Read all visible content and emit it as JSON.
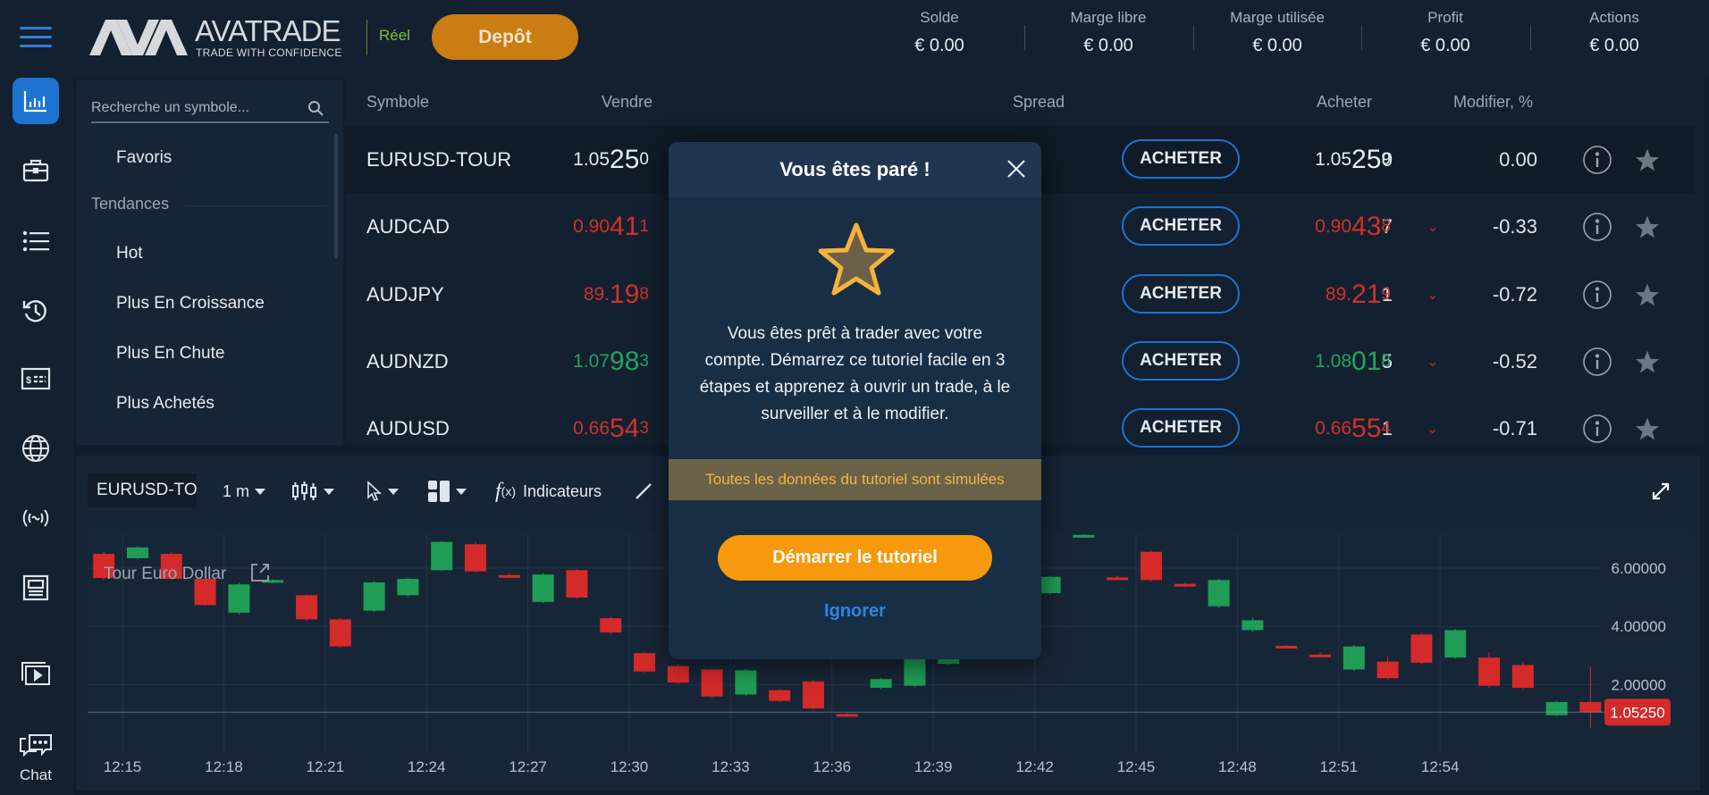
{
  "header": {
    "logo_text": "AVATRADE",
    "logo_tagline": "TRADE WITH CONFIDENCE",
    "account_type": "Réel",
    "deposit_label": "Depôt",
    "stats": [
      {
        "label": "Solde",
        "value": "€ 0.00"
      },
      {
        "label": "Marge libre",
        "value": "€ 0.00"
      },
      {
        "label": "Marge utilisée",
        "value": "€ 0.00"
      },
      {
        "label": "Profit",
        "value": "€ 0.00"
      },
      {
        "label": "Actions",
        "value": "€ 0.00"
      }
    ]
  },
  "rail": {
    "icons": [
      "chart-bars-icon",
      "briefcase-icon",
      "list-icon",
      "history-icon",
      "dollar-card-icon",
      "globe-icon",
      "signal-icon",
      "news-icon",
      "video-icon",
      "chat-icon"
    ],
    "chat_label": "Chat"
  },
  "symbols_panel": {
    "search_placeholder": "Recherche un symbole...",
    "favorites": "Favoris",
    "trends_heading": "Tendances",
    "trends": [
      "Hot",
      "Plus En Croissance",
      "Plus En Chute",
      "Plus Achetés"
    ]
  },
  "table": {
    "headers": {
      "symbol": "Symbole",
      "sell": "Vendre",
      "spread": "Spread",
      "buy": "Acheter",
      "change": "Modifier, %"
    },
    "buy_label": "ACHETER",
    "rows": [
      {
        "symbol": "EURUSD-TOUR",
        "sell": {
          "pre": "1.05",
          "big": "25",
          "post": "0"
        },
        "spread": "0",
        "buy": {
          "pre": "1.05",
          "big": "25",
          "post": "9"
        },
        "change": "0.00",
        "direction": "flat",
        "color": "#e6ebf0"
      },
      {
        "symbol": "AUDCAD",
        "sell": {
          "pre": "0.90",
          "big": "41",
          "post": "1"
        },
        "spread": "7",
        "buy": {
          "pre": "0.90",
          "big": "43",
          "post": "8"
        },
        "change": "-0.33",
        "direction": "down",
        "color": "#d0312d"
      },
      {
        "symbol": "AUDJPY",
        "sell": {
          "pre": "89.",
          "big": "19",
          "post": "8"
        },
        "spread": "1",
        "buy": {
          "pre": "89.",
          "big": "21",
          "post": "9"
        },
        "change": "-0.72",
        "direction": "down",
        "color": "#d0312d"
      },
      {
        "symbol": "AUDNZD",
        "sell": {
          "pre": "1.07",
          "big": "98",
          "post": "3"
        },
        "spread": "5",
        "buy": {
          "pre": "1.08",
          "big": "01",
          "post": "8"
        },
        "change": "-0.52",
        "direction": "down",
        "color": "#22a45d"
      },
      {
        "symbol": "AUDUSD",
        "sell": {
          "pre": "0.66",
          "big": "54",
          "post": "3"
        },
        "spread": "1",
        "buy": {
          "pre": "0.66",
          "big": "55",
          "post": "4"
        },
        "change": "-0.71",
        "direction": "down",
        "color": "#d0312d"
      }
    ]
  },
  "chart_toolbar": {
    "symbol": "EURUSD-TOUR",
    "interval": "1 m",
    "indicators_label": "Indicateurs"
  },
  "chart_data": {
    "type": "candlestick",
    "title": "Tour Euro Dollar",
    "ylim": [
      0,
      7.5
    ],
    "y_ticks": [
      "6.00000",
      "4.00000",
      "2.00000"
    ],
    "x_ticks": [
      "12:15",
      "12:18",
      "12:21",
      "12:24",
      "12:27",
      "12:30",
      "12:33",
      "12:36",
      "12:39",
      "12:42",
      "12:45",
      "12:48",
      "12:51",
      "12:54"
    ],
    "last_price": "1.05250",
    "up_color": "#1f9d55",
    "down_color": "#d42a2a",
    "grid": true,
    "candles": [
      [
        "12:14",
        6.49,
        6.55,
        5.6,
        5.66
      ],
      [
        "12:15",
        6.34,
        6.75,
        6.3,
        6.71
      ],
      [
        "12:16",
        6.49,
        6.55,
        5.6,
        5.63
      ],
      [
        "12:17",
        5.63,
        5.7,
        4.7,
        4.73
      ],
      [
        "12:18",
        4.47,
        5.5,
        4.4,
        5.44
      ],
      [
        "12:19",
        5.51,
        5.62,
        5.48,
        5.59
      ],
      [
        "12:20",
        5.07,
        5.1,
        4.2,
        4.24
      ],
      [
        "12:21",
        4.24,
        4.28,
        3.28,
        3.31
      ],
      [
        "12:22",
        4.54,
        5.55,
        4.5,
        5.51
      ],
      [
        "12:23",
        5.07,
        5.66,
        5.03,
        5.63
      ],
      [
        "12:24",
        5.93,
        6.93,
        5.9,
        6.9
      ],
      [
        "12:25",
        6.82,
        6.9,
        5.85,
        5.89
      ],
      [
        "12:26",
        5.76,
        5.82,
        5.68,
        5.72
      ],
      [
        "12:27",
        4.84,
        5.82,
        4.8,
        5.78
      ],
      [
        "12:28",
        5.93,
        5.97,
        4.96,
        4.99
      ],
      [
        "12:29",
        4.28,
        4.32,
        3.75,
        3.79
      ],
      [
        "12:30",
        3.08,
        3.12,
        2.4,
        2.45
      ],
      [
        "12:31",
        2.64,
        2.7,
        2.03,
        2.07
      ],
      [
        "12:32",
        2.52,
        2.56,
        1.55,
        1.59
      ],
      [
        "12:33",
        1.66,
        2.53,
        1.62,
        2.49
      ],
      [
        "12:34",
        1.81,
        1.85,
        1.4,
        1.44
      ],
      [
        "12:35",
        2.11,
        2.15,
        1.14,
        1.18
      ],
      [
        "12:36",
        0.99,
        1.02,
        0.9,
        0.92
      ],
      [
        "12:37",
        1.89,
        2.23,
        1.85,
        2.19
      ],
      [
        "12:38",
        1.96,
        2.94,
        1.92,
        2.9
      ],
      [
        "12:39",
        2.71,
        3.12,
        2.68,
        3.08
      ],
      [
        "12:42",
        5.14,
        5.74,
        5.1,
        5.7
      ],
      [
        "12:43",
        7.1,
        7.2,
        7.04,
        7.14
      ],
      [
        "12:44",
        5.68,
        5.74,
        5.6,
        5.64
      ],
      [
        "12:45",
        6.56,
        6.6,
        5.55,
        5.59
      ],
      [
        "12:46",
        5.46,
        5.5,
        5.35,
        5.42
      ],
      [
        "12:47",
        4.69,
        5.63,
        4.65,
        5.59
      ],
      [
        "12:48",
        3.87,
        4.3,
        3.8,
        4.21
      ],
      [
        "12:49",
        3.33,
        3.36,
        3.28,
        3.29
      ],
      [
        "12:50",
        3.03,
        3.1,
        2.98,
        2.99
      ],
      [
        "12:51",
        2.52,
        3.35,
        2.48,
        3.31
      ],
      [
        "12:52",
        2.79,
        2.95,
        2.18,
        2.22
      ],
      [
        "12:53",
        3.72,
        3.76,
        2.7,
        2.75
      ],
      [
        "12:54",
        2.93,
        3.9,
        2.9,
        3.87
      ],
      [
        "12:55",
        2.93,
        3.1,
        1.9,
        1.96
      ],
      [
        "12:56",
        2.67,
        2.8,
        1.85,
        1.89
      ],
      [
        "12:57",
        0.95,
        1.44,
        0.92,
        1.4
      ],
      [
        "12:58",
        1.4,
        2.6,
        0.5,
        1.05
      ]
    ]
  },
  "modal": {
    "title": "Vous êtes paré !",
    "body": "Vous êtes prêt à trader avec votre compte. Démarrez ce tutoriel facile en 3 étapes et apprenez à ouvrir un trade, à le surveiller et à le modifier.",
    "banner": "Toutes les données du tutoriel sont simulées",
    "start_label": "Démarrer le tutoriel",
    "ignore_label": "Ignorer",
    "accent": "#f7990c"
  }
}
